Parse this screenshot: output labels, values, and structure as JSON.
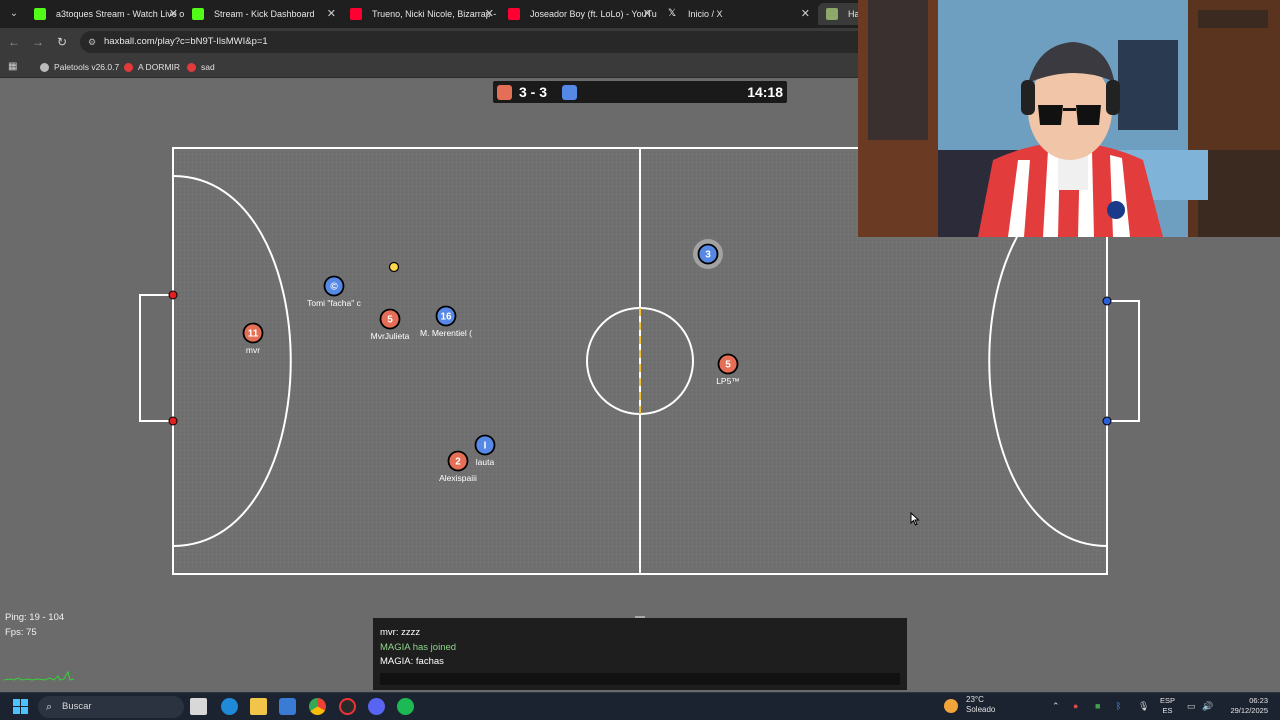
{
  "browser": {
    "tabs": [
      {
        "title": "a3toques Stream - Watch Live o",
        "close": "✕",
        "fav_color": "#53fc18"
      },
      {
        "title": "Stream - Kick Dashboard",
        "close": "✕",
        "fav_color": "#53fc18"
      },
      {
        "title": "Trueno, Nicki Nicole, Bizarrap -",
        "close": "✕",
        "fav_color": "#ff0033"
      },
      {
        "title": "Joseador Boy (ft. LoLo) - YouTu",
        "close": "✕",
        "fav_color": "#ff0033"
      },
      {
        "title": "Inicio / X",
        "close": "✕",
        "fav_color": "#ffffff"
      },
      {
        "title": "Haxb",
        "close": "",
        "fav_color": "#8ca86a"
      }
    ],
    "url": "haxball.com/play?c=bN9T-IlsMWI&p=1",
    "bookmarks": [
      {
        "label": "Paletools v26.0.7",
        "color": "#bbbbbb"
      },
      {
        "label": "A DORMIR",
        "color": "#e23a3a"
      },
      {
        "label": "sad",
        "color": "#e23a3a"
      }
    ]
  },
  "scoreboard": {
    "score": "3 - 3",
    "time": "14:18",
    "red_color": "#e56e56",
    "blue_color": "#5689e5"
  },
  "colors": {
    "field": "#6b6b6b",
    "red_team": "#e56e56",
    "blue_team": "#5689e5",
    "ball": "#ffd84a"
  },
  "players": [
    {
      "team": "blue",
      "number": "©",
      "name": "Tomi \"facha\" c"
    },
    {
      "team": "red",
      "number": "11",
      "name": "mvr"
    },
    {
      "team": "red",
      "number": "5",
      "name": "MvrJulieta"
    },
    {
      "team": "blue",
      "number": "16",
      "name": "M. Merentiel ("
    },
    {
      "team": "blue",
      "number": "3",
      "name": ""
    },
    {
      "team": "red",
      "number": "5",
      "name": "LP5™"
    },
    {
      "team": "blue",
      "number": "I",
      "name": "lauta"
    },
    {
      "team": "red",
      "number": "2",
      "name": "Alexispaiii"
    }
  ],
  "stats": {
    "ping": "Ping: 19 - 104",
    "fps": "Fps: 75"
  },
  "chat": {
    "messages": [
      {
        "text": "mvr: zzzz",
        "type": "msg"
      },
      {
        "text": "MAGIA has joined",
        "type": "join"
      },
      {
        "text": "MAGIA: fachas",
        "type": "msg"
      }
    ]
  },
  "taskbar": {
    "search_placeholder": "Buscar",
    "weather_temp": "23°C",
    "weather_desc": "Soleado",
    "lang_top": "ESP",
    "lang_bottom": "ES",
    "time": "06:23",
    "date": "29/12/2025"
  }
}
